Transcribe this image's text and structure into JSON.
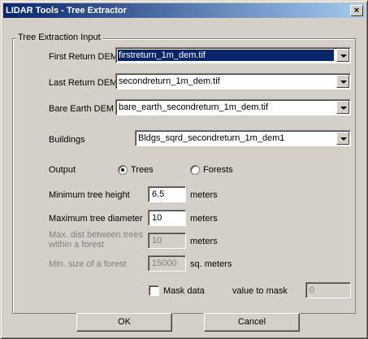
{
  "window": {
    "title": "LIDAR Tools - Tree Extractor",
    "close_label": "×"
  },
  "group": {
    "title": "Tree Extraction Input"
  },
  "fields": {
    "first_return": {
      "label": "First Return DEM",
      "value": "firstreturn_1m_dem.tif"
    },
    "last_return": {
      "label": "Last Return DEM",
      "value": "secondreturn_1m_dem.tif"
    },
    "bare_earth": {
      "label": "Bare Earth DEM",
      "value": "bare_earth_secondreturn_1m_dem.tif"
    },
    "buildings": {
      "label": "Buildings",
      "value": "Bldgs_sqrd_secondreturn_1m_dem1"
    }
  },
  "output": {
    "label": "Output",
    "options": [
      {
        "label": "Trees",
        "checked": true
      },
      {
        "label": "Forests",
        "checked": false
      }
    ]
  },
  "params": {
    "min_tree_height": {
      "label": "Minimum tree height",
      "value": "6.5",
      "unit": "meters"
    },
    "max_tree_diameter": {
      "label": "Maximum tree diameter",
      "value": "10",
      "unit": "meters"
    },
    "max_dist": {
      "label_line1": "Max. dist between trees",
      "label_line2": "within a forest",
      "value": "10",
      "unit": "meters"
    },
    "min_forest_size": {
      "label": "Min. size of a forest",
      "value": "15000",
      "unit": "sq. meters"
    }
  },
  "mask": {
    "checkbox_label": "Mask data",
    "checked": false,
    "value_label": "value to mask",
    "value": "0"
  },
  "buttons": {
    "ok": "OK",
    "cancel": "Cancel"
  }
}
